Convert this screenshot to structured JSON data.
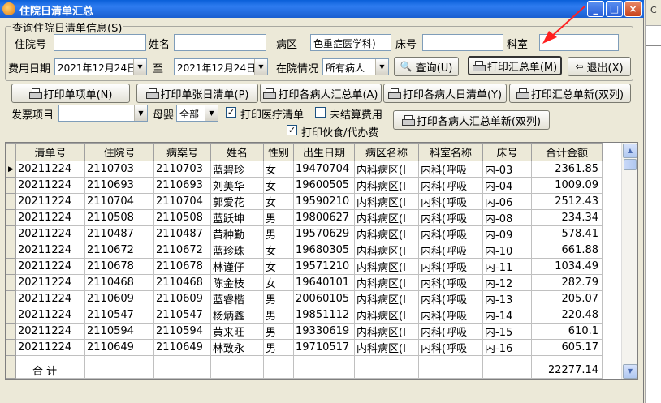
{
  "window": {
    "title": "住院日清单汇总"
  },
  "titlebar_buttons": {
    "min": "_",
    "max": "□",
    "close": "×"
  },
  "side": {
    "mark": "C"
  },
  "query": {
    "group_title": "查询住院日清单信息(S)",
    "inpatient_no_label": "住院号",
    "name_label": "姓名",
    "ward_label": "病区",
    "ward_value": "色重症医学科)",
    "bed_label": "床号",
    "dept_label": "科室",
    "date_label": "费用日期",
    "date_from": "2021年12月24日",
    "to_label": "至",
    "date_to": "2021年12月24日",
    "status_label": "在院情况",
    "status_value": "所有病人",
    "query_button": "查询(U)",
    "print_summary_button": "打印汇总单(M)",
    "exit_button": "退出(X)"
  },
  "print_buttons": {
    "single_item": "打印单项单(N)",
    "single_day": "打印单张日清单(P)",
    "each_summary": "打印各病人汇总单(A)",
    "each_day": "打印各病人日清单(Y)",
    "summary_new": "打印汇总单新(双列)",
    "each_summary_new": "打印各病人汇总单新(双列)"
  },
  "filters": {
    "invoice_label": "发票项目",
    "invoice_value": "",
    "mother_baby_label": "母婴",
    "mother_baby_value": "全部",
    "print_medical_label": "打印医疗清单",
    "print_medical_checked": true,
    "unsettled_label": "未结算费用",
    "unsettled_checked": false,
    "print_meal_label": "打印伙食/代办费",
    "print_meal_checked": true
  },
  "table": {
    "columns": [
      "清单号",
      "住院号",
      "病案号",
      "姓名",
      "性别",
      "出生日期",
      "病区名称",
      "科室名称",
      "床号",
      "合计金额"
    ],
    "rows": [
      [
        "20211224",
        "2110703",
        "2110703",
        "蓝碧珍",
        "女",
        "19470704",
        "内科病区(I",
        "内科(呼吸",
        "内-03",
        "2361.85"
      ],
      [
        "20211224",
        "2110693",
        "2110693",
        "刘美华",
        "女",
        "19600505",
        "内科病区(I",
        "内科(呼吸",
        "内-04",
        "1009.09"
      ],
      [
        "20211224",
        "2110704",
        "2110704",
        "郭爱花",
        "女",
        "19590210",
        "内科病区(I",
        "内科(呼吸",
        "内-06",
        "2512.43"
      ],
      [
        "20211224",
        "2110508",
        "2110508",
        "蓝跃坤",
        "男",
        "19800627",
        "内科病区(I",
        "内科(呼吸",
        "内-08",
        "234.34"
      ],
      [
        "20211224",
        "2110487",
        "2110487",
        "黄种勤",
        "男",
        "19570629",
        "内科病区(I",
        "内科(呼吸",
        "内-09",
        "578.41"
      ],
      [
        "20211224",
        "2110672",
        "2110672",
        "蓝珍珠",
        "女",
        "19680305",
        "内科病区(I",
        "内科(呼吸",
        "内-10",
        "661.88"
      ],
      [
        "20211224",
        "2110678",
        "2110678",
        "林谨仔",
        "女",
        "19571210",
        "内科病区(I",
        "内科(呼吸",
        "内-11",
        "1034.49"
      ],
      [
        "20211224",
        "2110468",
        "2110468",
        "陈金枝",
        "女",
        "19640101",
        "内科病区(I",
        "内科(呼吸",
        "内-12",
        "282.79"
      ],
      [
        "20211224",
        "2110609",
        "2110609",
        "蓝睿楷",
        "男",
        "20060105",
        "内科病区(I",
        "内科(呼吸",
        "内-13",
        "205.07"
      ],
      [
        "20211224",
        "2110547",
        "2110547",
        "杨炳鑫",
        "男",
        "19851112",
        "内科病区(I",
        "内科(呼吸",
        "内-14",
        "220.48"
      ],
      [
        "20211224",
        "2110594",
        "2110594",
        "黄来旺",
        "男",
        "19330619",
        "内科病区(I",
        "内科(呼吸",
        "内-15",
        "610.1"
      ],
      [
        "20211224",
        "2110649",
        "2110649",
        "林致永",
        "男",
        "19710517",
        "内科病区(I",
        "内科(呼吸",
        "内-16",
        "605.17"
      ]
    ],
    "total_label": "合 计",
    "total_value": "22277.14"
  },
  "colors": {
    "titlebar": "#0a5fd8",
    "face": "#ECE9D8",
    "annotation_arrow": "#ff2020"
  }
}
